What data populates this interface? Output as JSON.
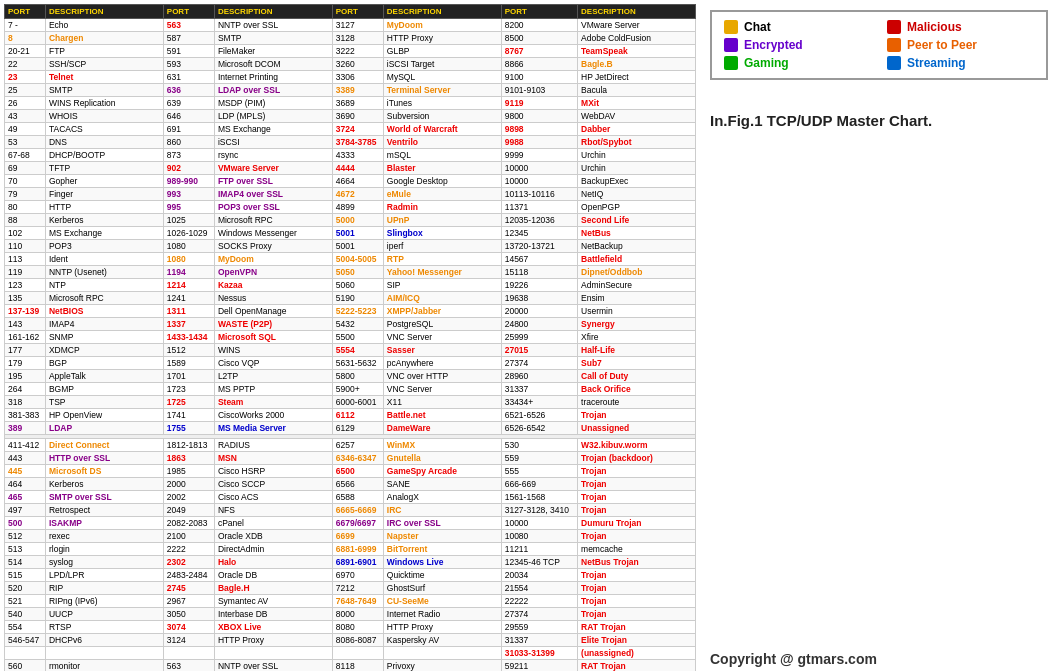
{
  "legend": {
    "items": [
      {
        "id": "chat",
        "label": "Chat",
        "color": "#e8a800",
        "class": "legend-chat"
      },
      {
        "id": "malicious",
        "label": "Malicious",
        "color": "#cc0000",
        "class": "legend-malicious"
      },
      {
        "id": "encrypted",
        "label": "Encrypted",
        "color": "#6600cc",
        "class": "legend-encrypted"
      },
      {
        "id": "p2p",
        "label": "Peer to Peer",
        "color": "#e86000",
        "class": "legend-p2p"
      },
      {
        "id": "gaming",
        "label": "Gaming",
        "color": "#00aa00",
        "class": "legend-gaming"
      },
      {
        "id": "streaming",
        "label": "Streaming",
        "color": "#0066cc",
        "class": "legend-streaming"
      }
    ]
  },
  "chart_title": "In.Fig.1 TCP/UDP Master Chart.",
  "copyright": "Copyright @ gtmars.com",
  "headers": [
    "PORT",
    "DESCRIPTION",
    "PORT",
    "DESCRIPTION",
    "PORT",
    "DESCRIPTION",
    "PORT",
    "DESCRIPTION"
  ]
}
